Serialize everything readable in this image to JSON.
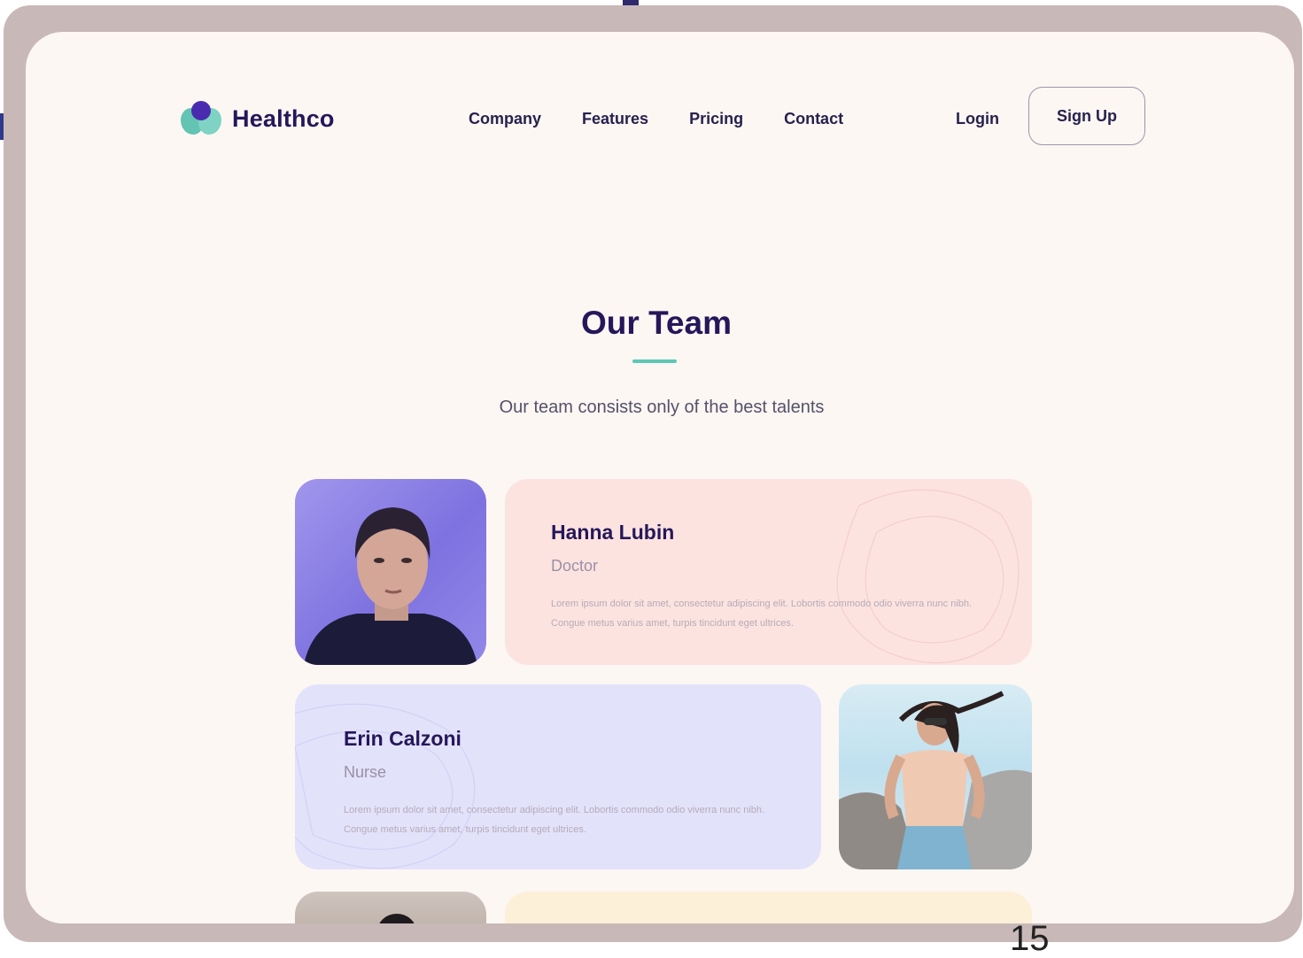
{
  "brand": {
    "name": "Healthco"
  },
  "nav": {
    "items": [
      {
        "label": "Company"
      },
      {
        "label": "Features"
      },
      {
        "label": "Pricing"
      },
      {
        "label": "Contact"
      }
    ],
    "login_label": "Login",
    "signup_label": "Sign Up"
  },
  "section": {
    "title": "Our Team",
    "subtitle": "Our team consists only of the best talents"
  },
  "team": [
    {
      "name": "Hanna Lubin",
      "role": "Doctor",
      "description": "Lorem ipsum dolor sit amet, consectetur adipiscing elit. Lobortis commodo odio viverra nunc nibh. Congue metus varius amet, turpis tincidunt eget ultrices.",
      "card_color": "#fde3df"
    },
    {
      "name": "Erin Calzoni",
      "role": "Nurse",
      "description": "Lorem ipsum dolor sit amet, consectetur adipiscing elit. Lobortis commodo odio viverra nunc nibh. Congue metus varius amet, turpis tincidunt eget ultrices.",
      "card_color": "#e3e2fb"
    },
    {
      "card_color": "#fdf0d9"
    }
  ],
  "page_number": "15",
  "colors": {
    "primary": "#25175a",
    "accent": "#5cc7b5",
    "background": "#fcf7f3",
    "frame": "#c9b8b8"
  }
}
